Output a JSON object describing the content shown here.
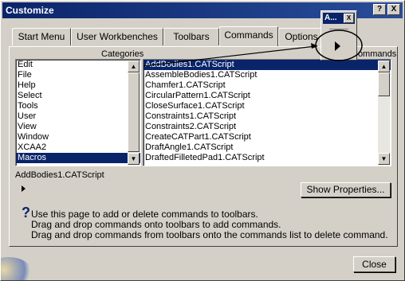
{
  "window": {
    "title": "Customize",
    "help_btn": "?",
    "close_btn": "X"
  },
  "tabs": [
    "Start Menu",
    "User Workbenches",
    "Toolbars",
    "Commands",
    "Options"
  ],
  "active_tab": "Commands",
  "categories": {
    "label": "Categories",
    "items": [
      "Edit",
      "File",
      "Help",
      "Select",
      "Tools",
      "User",
      "View",
      "Window",
      "XCAA2",
      "Macros"
    ],
    "selected": "Macros"
  },
  "commands": {
    "label": "Commands",
    "items": [
      "AddBodies1.CATScript",
      "AssembleBodies1.CATScript",
      "Chamfer1.CATScript",
      "CircularPattern1.CATScript",
      "CloseSurface1.CATScript",
      "Constraints1.CATScript",
      "Constraints2.CATScript",
      "CreateCATPart1.CATScript",
      "DraftAngle1.CATScript",
      "DraftedFilletedPad1.CATScript"
    ],
    "selected": "AddBodies1.CATScript"
  },
  "selected_command_name": "AddBodies1.CATScript",
  "show_properties_label": "Show Properties...",
  "help_text": [
    "Use this page to add or delete commands to toolbars.",
    "Drag and drop commands onto toolbars to add commands.",
    "Drag and drop commands from toolbars onto the commands list to delete command."
  ],
  "close_label": "Close",
  "popup": {
    "title": "A...",
    "close_btn": "X"
  }
}
